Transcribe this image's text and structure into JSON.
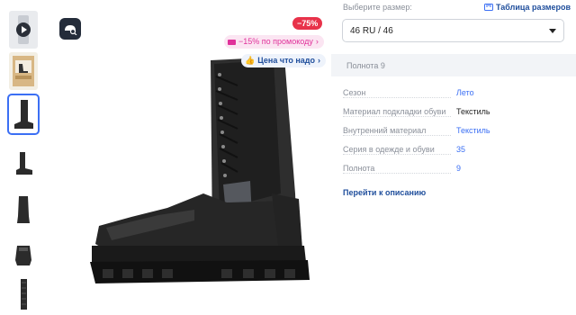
{
  "thumbnails": [
    {
      "name": "thumb-video",
      "icon": "play-icon"
    },
    {
      "name": "thumb-package"
    },
    {
      "name": "thumb-boot-side-selected",
      "selected": true
    },
    {
      "name": "thumb-boot-side"
    },
    {
      "name": "thumb-boot-front"
    },
    {
      "name": "thumb-boot-back"
    },
    {
      "name": "thumb-boot-sole"
    }
  ],
  "badges": {
    "discount": "−75%",
    "promo": "−15% по промокоду",
    "price": "Цена что надо"
  },
  "size": {
    "label": "Выберите размер:",
    "table_link": "Таблица размеров",
    "selected": "46 RU / 46"
  },
  "fullness_box": "Полнота 9",
  "specs": [
    {
      "key": "Сезон",
      "value": "Лето",
      "link": true
    },
    {
      "key": "Материал подкладки обуви",
      "value": "Текстиль",
      "link": false
    },
    {
      "key": "Внутренний материал",
      "value": "Текстиль",
      "link": true
    },
    {
      "key": "Серия в одежде и обуви",
      "value": "35",
      "link": true
    },
    {
      "key": "Полнота",
      "value": "9",
      "link": true
    }
  ],
  "goto_description": "Перейти к описанию",
  "colors": {
    "accent": "#3b6ff4",
    "discount": "#e8324a",
    "promo": "#e0319a",
    "link_dark": "#1f4e9c"
  }
}
